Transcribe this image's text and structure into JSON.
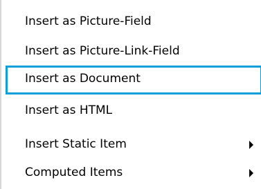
{
  "menu": {
    "items": [
      {
        "label": "Insert as Picture-Field",
        "has_submenu": false,
        "focused": false
      },
      {
        "label": "Insert as Picture-Link-Field",
        "has_submenu": false,
        "focused": false
      },
      {
        "label": "Insert as Document",
        "has_submenu": false,
        "focused": true
      },
      {
        "label": "Insert as HTML",
        "has_submenu": false,
        "focused": false
      },
      {
        "label": "Insert Static Item",
        "has_submenu": true,
        "focused": false
      },
      {
        "label": "Computed Items",
        "has_submenu": true,
        "focused": false
      }
    ]
  },
  "colors": {
    "focus_border": "#0a9fd8",
    "menu_background": "#ffffff",
    "text": "#000000"
  },
  "icons": {
    "submenu_arrow": "triangle-right-icon"
  }
}
